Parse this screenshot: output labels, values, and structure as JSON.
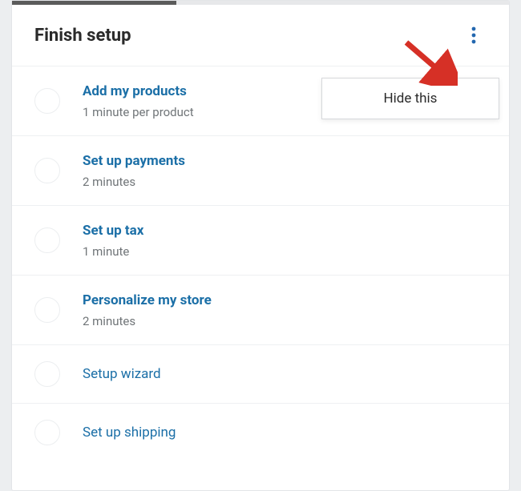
{
  "header": {
    "title": "Finish setup"
  },
  "progress": {
    "percent": 33
  },
  "popover": {
    "hide_label": "Hide this"
  },
  "tasks": [
    {
      "title": "Add my products",
      "sub": "1 minute per product",
      "bold": true
    },
    {
      "title": "Set up payments",
      "sub": "2 minutes",
      "bold": true
    },
    {
      "title": "Set up tax",
      "sub": "1 minute",
      "bold": true
    },
    {
      "title": "Personalize my store",
      "sub": "2 minutes",
      "bold": true
    },
    {
      "title": "Setup wizard",
      "sub": "",
      "bold": false
    },
    {
      "title": "Set up shipping",
      "sub": "",
      "bold": false
    }
  ],
  "colors": {
    "link": "#1b6fa7",
    "arrow": "#d63026"
  }
}
